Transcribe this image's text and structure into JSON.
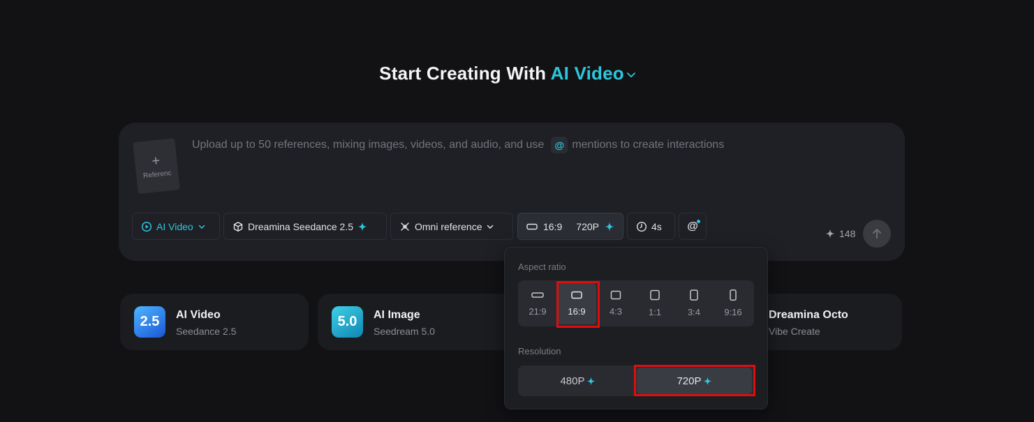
{
  "hero": {
    "title_prefix": "Start Creating With",
    "title_accent": "AI Video"
  },
  "composer": {
    "reference_tile_label": "Referenc",
    "placeholder_before": "Upload up to 50 references, mixing images, videos, and audio, and use",
    "placeholder_at": "@",
    "placeholder_after": "mentions to create interactions",
    "toolbar": {
      "mode": "AI Video",
      "model": "Dreamina Seedance 2.5",
      "reference": "Omni reference",
      "aspect": "16:9",
      "resolution": "720P",
      "duration": "4s",
      "mention": "@"
    },
    "credits": "148"
  },
  "apps": [
    {
      "title": "AI Video",
      "subtitle": "Seedance 2.5",
      "badge": "2.5"
    },
    {
      "title": "AI Image",
      "subtitle": "Seedream 5.0",
      "badge": "5.0"
    },
    {
      "title": "Dreamina Octo",
      "subtitle": "Vibe Create"
    }
  ],
  "popup": {
    "aspect_label": "Aspect ratio",
    "aspect_options": [
      "21:9",
      "16:9",
      "4:3",
      "1:1",
      "3:4",
      "9:16"
    ],
    "aspect_selected": "16:9",
    "resolution_label": "Resolution",
    "resolution_options": [
      "480P",
      "720P"
    ],
    "resolution_selected": "720P"
  },
  "colors": {
    "accent": "#2bc7dd",
    "background": "#121215",
    "highlight": "#e00d0d"
  }
}
